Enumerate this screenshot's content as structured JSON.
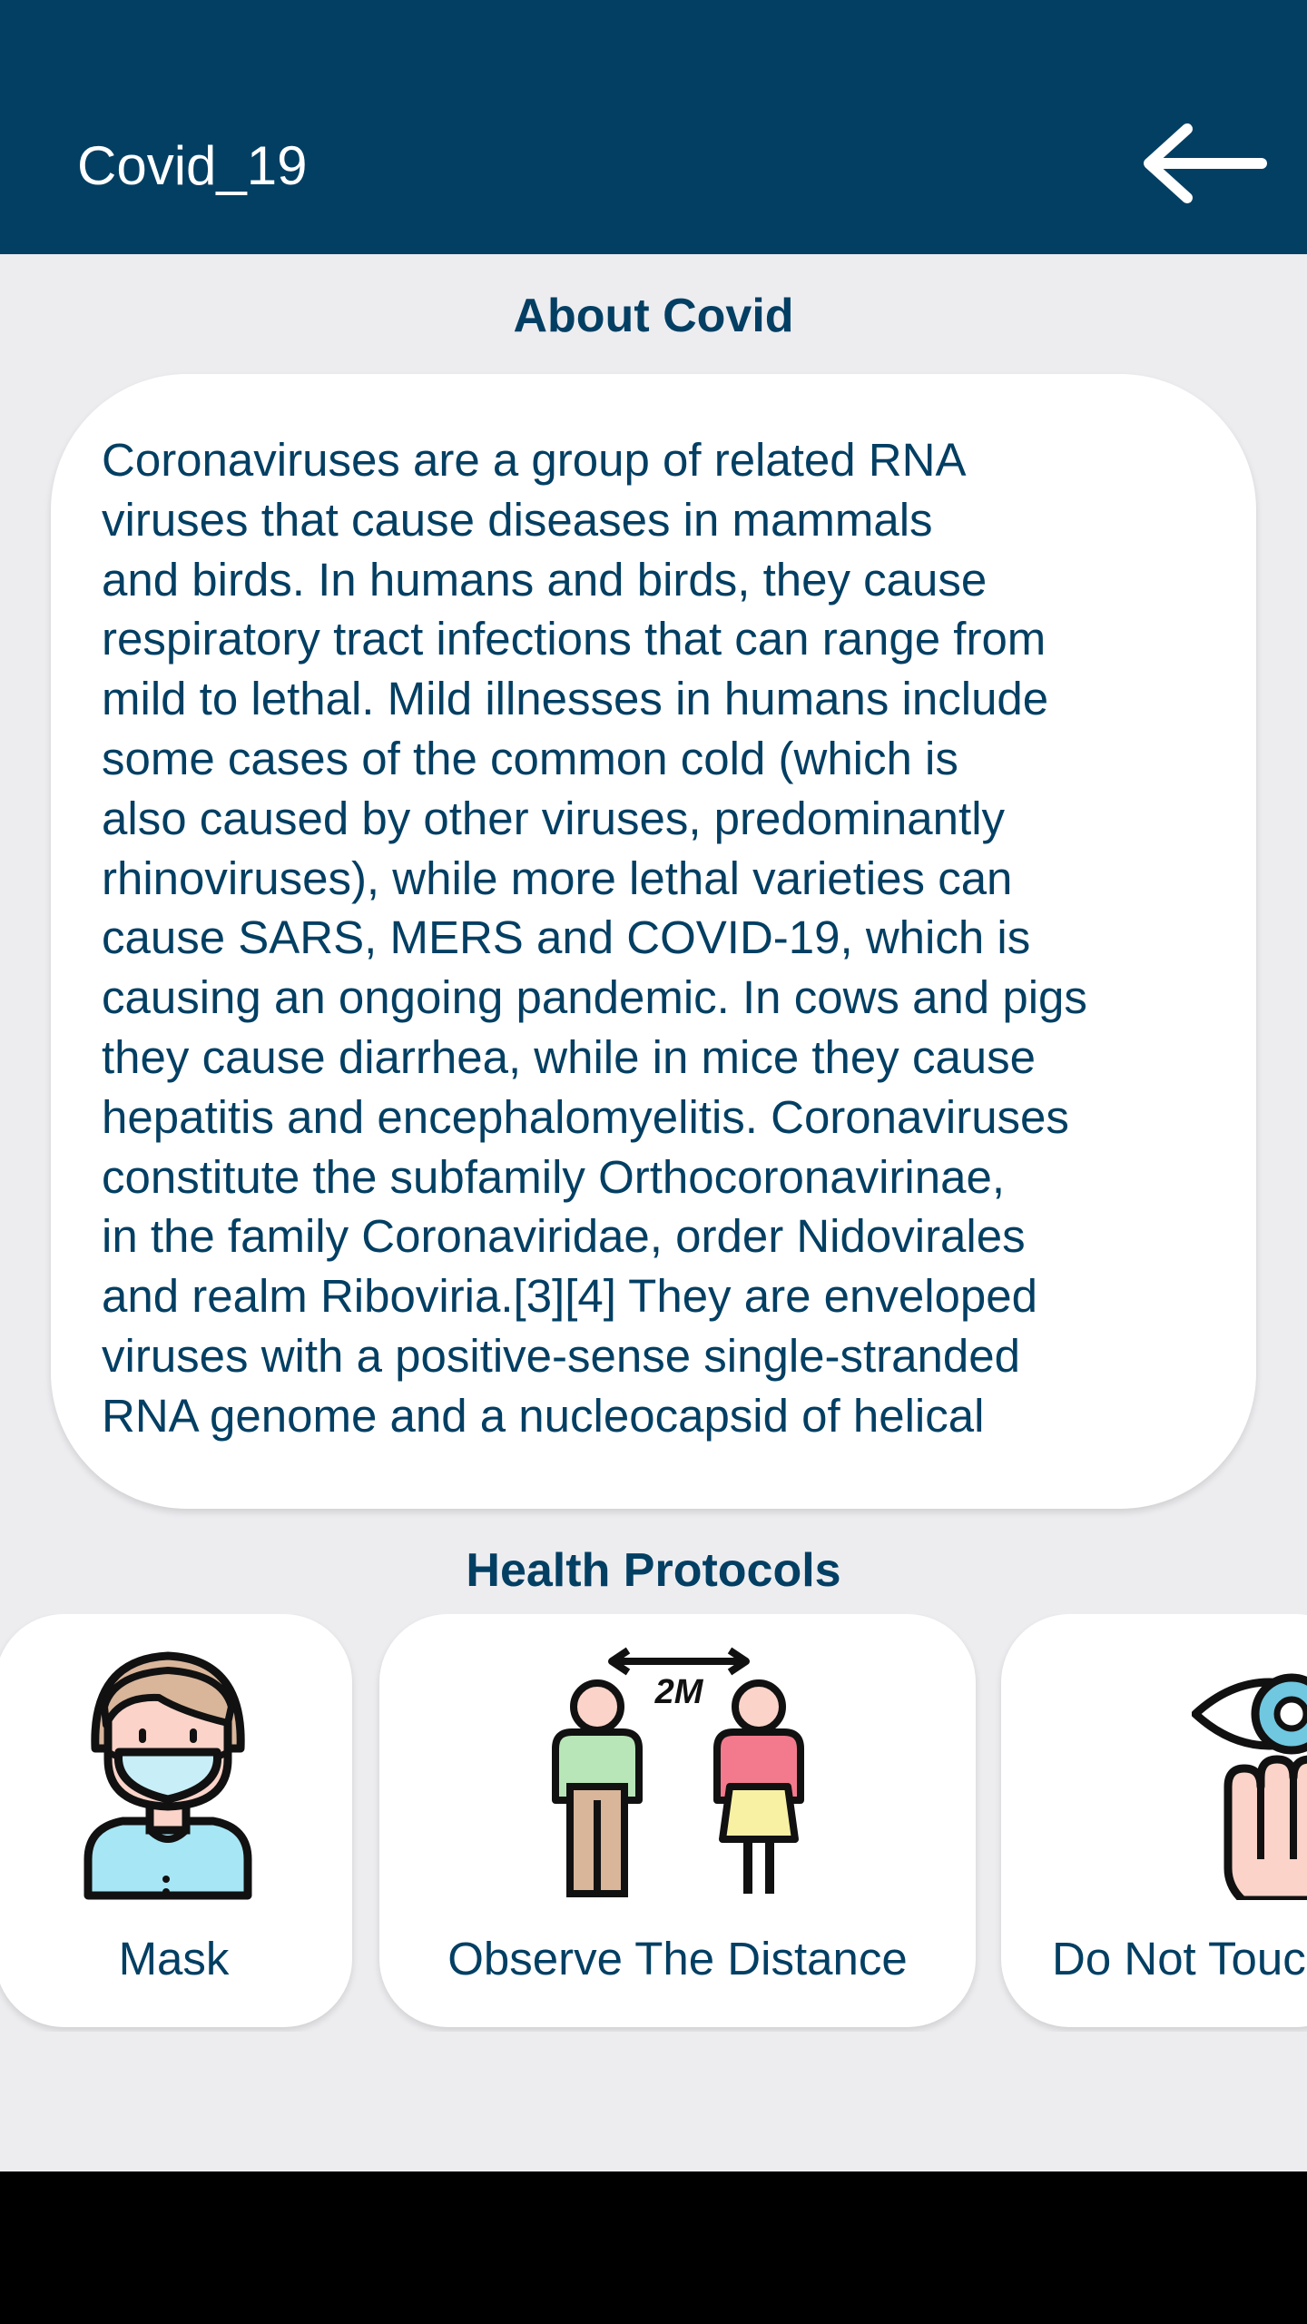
{
  "app_bar": {
    "title": "Covid_19",
    "back_icon": "arrow-left-icon",
    "background_color": "#033f63"
  },
  "about": {
    "heading": "About Covid",
    "text": "Coronaviruses are a group of related RNA\nviruses that cause diseases in mammals\nand birds. In humans and birds, they cause\nrespiratory tract infections that can range from\nmild to lethal. Mild illnesses in humans include\nsome cases of the common cold (which is\nalso caused by other viruses, predominantly\nrhinoviruses), while more lethal varieties can\ncause SARS, MERS and COVID-19, which is\ncausing an ongoing pandemic. In cows and pigs\nthey cause diarrhea, while in mice they cause\nhepatitis and encephalomyelitis. Coronaviruses\nconstitute the subfamily Orthocoronavirinae,\nin the family Coronaviridae, order Nidovirales\nand realm Riboviria.[3][4] They are enveloped\nviruses with a positive-sense single-stranded\nRNA genome and a nucleocapsid of helical\nsymmetry."
  },
  "protocols": {
    "heading": "Health Protocols",
    "items": [
      {
        "label": "Mask",
        "icon": "masked-person-icon"
      },
      {
        "label": "Observe The Distance",
        "icon": "social-distance-icon",
        "distance_text": "2M"
      },
      {
        "label": "Do Not Touch Face",
        "icon": "eye-hand-icon"
      }
    ]
  },
  "colors": {
    "primary": "#033f63",
    "background": "#ededf0",
    "card": "#ffffff"
  }
}
